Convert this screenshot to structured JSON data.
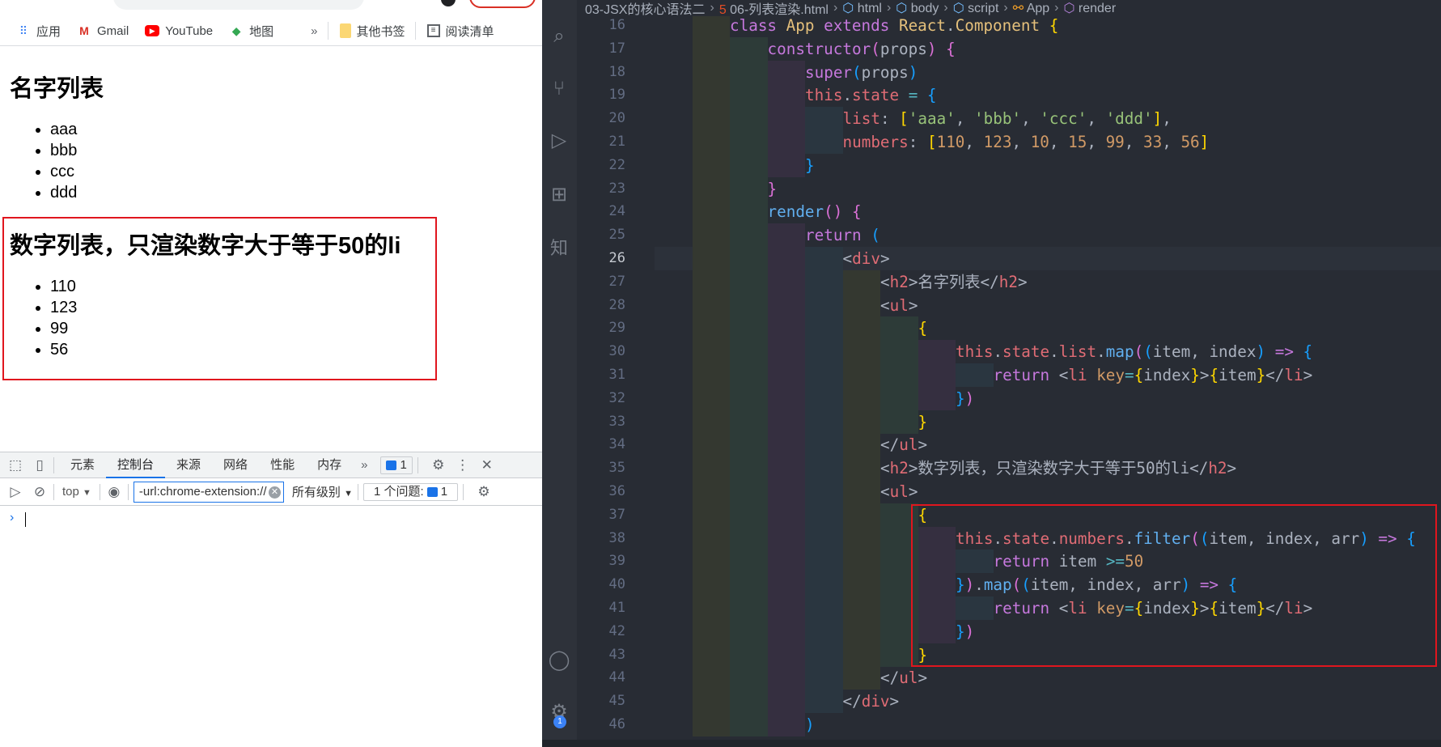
{
  "bookmarks": [
    {
      "label": "应用",
      "icon": "apps-grid-icon"
    },
    {
      "label": "Gmail",
      "icon": "gmail-icon"
    },
    {
      "label": "YouTube",
      "icon": "youtube-icon"
    },
    {
      "label": "地图",
      "icon": "maps-icon"
    }
  ],
  "bookmarks_more": "»",
  "other_bookmarks": "其他书签",
  "reading_list": "阅读清单",
  "page": {
    "h2_names": "名字列表",
    "names": [
      "aaa",
      "bbb",
      "ccc",
      "ddd"
    ],
    "h2_numbers": "数字列表，只渲染数字大于等于50的li",
    "numbers": [
      "110",
      "123",
      "99",
      "56"
    ]
  },
  "devtools": {
    "tabs": [
      "元素",
      "控制台",
      "来源",
      "网络",
      "性能",
      "内存"
    ],
    "active_tab": "控制台",
    "more": "»",
    "issues_badge": "1",
    "context": "top",
    "filter_value": "-url:chrome-extension://",
    "levels": "所有级别",
    "issues_label": "1 个问题:",
    "issues_count": "1",
    "prompt": "›"
  },
  "editor": {
    "breadcrumbs": [
      "03-JSX的核心语法二",
      "06-列表渲染.html",
      "html",
      "body",
      "script",
      "App",
      "render"
    ],
    "current_line": 26,
    "notification_count": "1",
    "highlight_color": "#e0161e",
    "lines": [
      {
        "n": 16,
        "i": 2,
        "t": [
          [
            "kw",
            "class "
          ],
          [
            "cls",
            "App "
          ],
          [
            "kw",
            "extends "
          ],
          [
            "cls",
            "React"
          ],
          [
            "df",
            "."
          ],
          [
            "cls",
            "Component "
          ],
          [
            "b1",
            "{"
          ]
        ]
      },
      {
        "n": 17,
        "i": 3,
        "t": [
          [
            "kw",
            "constructor"
          ],
          [
            "b2",
            "("
          ],
          [
            "df",
            "props"
          ],
          [
            "b2",
            ")"
          ],
          [
            "df",
            " "
          ],
          [
            "b2",
            "{"
          ]
        ]
      },
      {
        "n": 18,
        "i": 4,
        "t": [
          [
            "kw",
            "super"
          ],
          [
            "b3",
            "("
          ],
          [
            "df",
            "props"
          ],
          [
            "b3",
            ")"
          ]
        ]
      },
      {
        "n": 19,
        "i": 4,
        "t": [
          [
            "red",
            "this"
          ],
          [
            "df",
            "."
          ],
          [
            "red",
            "state "
          ],
          [
            "op",
            "= "
          ],
          [
            "b3",
            "{"
          ]
        ]
      },
      {
        "n": 20,
        "i": 5,
        "t": [
          [
            "red",
            "list"
          ],
          [
            "df",
            ": "
          ],
          [
            "b1",
            "["
          ],
          [
            "str",
            "'aaa'"
          ],
          [
            "df",
            ", "
          ],
          [
            "str",
            "'bbb'"
          ],
          [
            "df",
            ", "
          ],
          [
            "str",
            "'ccc'"
          ],
          [
            "df",
            ", "
          ],
          [
            "str",
            "'ddd'"
          ],
          [
            "b1",
            "]"
          ],
          [
            "df",
            ","
          ]
        ]
      },
      {
        "n": 21,
        "i": 5,
        "t": [
          [
            "red",
            "numbers"
          ],
          [
            "df",
            ": "
          ],
          [
            "b1",
            "["
          ],
          [
            "num",
            "110"
          ],
          [
            "df",
            ", "
          ],
          [
            "num",
            "123"
          ],
          [
            "df",
            ", "
          ],
          [
            "num",
            "10"
          ],
          [
            "df",
            ", "
          ],
          [
            "num",
            "15"
          ],
          [
            "df",
            ", "
          ],
          [
            "num",
            "99"
          ],
          [
            "df",
            ", "
          ],
          [
            "num",
            "33"
          ],
          [
            "df",
            ", "
          ],
          [
            "num",
            "56"
          ],
          [
            "b1",
            "]"
          ]
        ]
      },
      {
        "n": 22,
        "i": 4,
        "t": [
          [
            "b3",
            "}"
          ]
        ]
      },
      {
        "n": 23,
        "i": 3,
        "t": [
          [
            "b2",
            "}"
          ]
        ]
      },
      {
        "n": 24,
        "i": 3,
        "t": [
          [
            "fn",
            "render"
          ],
          [
            "b2",
            "()"
          ],
          [
            "df",
            " "
          ],
          [
            "b2",
            "{"
          ]
        ]
      },
      {
        "n": 25,
        "i": 4,
        "t": [
          [
            "kw",
            "return "
          ],
          [
            "b3",
            "("
          ]
        ]
      },
      {
        "n": 26,
        "i": 5,
        "t": [
          [
            "df",
            "<"
          ],
          [
            "red",
            "div"
          ],
          [
            "df",
            ">"
          ]
        ]
      },
      {
        "n": 27,
        "i": 6,
        "t": [
          [
            "df",
            "<"
          ],
          [
            "red",
            "h2"
          ],
          [
            "df",
            ">名字列表</"
          ],
          [
            "red",
            "h2"
          ],
          [
            "df",
            ">"
          ]
        ]
      },
      {
        "n": 28,
        "i": 6,
        "t": [
          [
            "df",
            "<"
          ],
          [
            "red",
            "ul"
          ],
          [
            "df",
            ">"
          ]
        ]
      },
      {
        "n": 29,
        "i": 7,
        "t": [
          [
            "b1",
            "{"
          ]
        ]
      },
      {
        "n": 30,
        "i": 8,
        "t": [
          [
            "red",
            "this"
          ],
          [
            "df",
            "."
          ],
          [
            "red",
            "state"
          ],
          [
            "df",
            "."
          ],
          [
            "red",
            "list"
          ],
          [
            "df",
            "."
          ],
          [
            "fn",
            "map"
          ],
          [
            "b2",
            "("
          ],
          [
            "b3",
            "("
          ],
          [
            "df",
            "item, index"
          ],
          [
            "b3",
            ")"
          ],
          [
            "df",
            " "
          ],
          [
            "kw",
            "=>"
          ],
          [
            "df",
            " "
          ],
          [
            "b3",
            "{"
          ]
        ]
      },
      {
        "n": 31,
        "i": 9,
        "t": [
          [
            "kw",
            "return "
          ],
          [
            "df",
            "<"
          ],
          [
            "red",
            "li "
          ],
          [
            "num",
            "key"
          ],
          [
            "op",
            "="
          ],
          [
            "b1",
            "{"
          ],
          [
            "df",
            "index"
          ],
          [
            "b1",
            "}"
          ],
          [
            "df",
            ">"
          ],
          [
            "b1",
            "{"
          ],
          [
            "df",
            "item"
          ],
          [
            "b1",
            "}"
          ],
          [
            "df",
            "</"
          ],
          [
            "red",
            "li"
          ],
          [
            "df",
            ">"
          ]
        ]
      },
      {
        "n": 32,
        "i": 8,
        "t": [
          [
            "b3",
            "}"
          ],
          [
            "b2",
            ")"
          ]
        ]
      },
      {
        "n": 33,
        "i": 7,
        "t": [
          [
            "b1",
            "}"
          ]
        ]
      },
      {
        "n": 34,
        "i": 6,
        "t": [
          [
            "df",
            "</"
          ],
          [
            "red",
            "ul"
          ],
          [
            "df",
            ">"
          ]
        ]
      },
      {
        "n": 35,
        "i": 6,
        "t": [
          [
            "df",
            "<"
          ],
          [
            "red",
            "h2"
          ],
          [
            "df",
            ">数字列表，只渲染数字大于等于50的li</"
          ],
          [
            "red",
            "h2"
          ],
          [
            "df",
            ">"
          ]
        ]
      },
      {
        "n": 36,
        "i": 6,
        "t": [
          [
            "df",
            "<"
          ],
          [
            "red",
            "ul"
          ],
          [
            "df",
            ">"
          ]
        ]
      },
      {
        "n": 37,
        "i": 7,
        "t": [
          [
            "b1",
            "{"
          ]
        ]
      },
      {
        "n": 38,
        "i": 8,
        "t": [
          [
            "red",
            "this"
          ],
          [
            "df",
            "."
          ],
          [
            "red",
            "state"
          ],
          [
            "df",
            "."
          ],
          [
            "red",
            "numbers"
          ],
          [
            "df",
            "."
          ],
          [
            "fn",
            "filter"
          ],
          [
            "b2",
            "("
          ],
          [
            "b3",
            "("
          ],
          [
            "df",
            "item, index, arr"
          ],
          [
            "b3",
            ")"
          ],
          [
            "df",
            " "
          ],
          [
            "kw",
            "=>"
          ],
          [
            "df",
            " "
          ],
          [
            "b3",
            "{"
          ]
        ]
      },
      {
        "n": 39,
        "i": 9,
        "t": [
          [
            "kw",
            "return "
          ],
          [
            "df",
            "item "
          ],
          [
            "op",
            ">="
          ],
          [
            "num",
            "50"
          ]
        ]
      },
      {
        "n": 40,
        "i": 8,
        "t": [
          [
            "b3",
            "}"
          ],
          [
            "b2",
            ")"
          ],
          [
            "df",
            "."
          ],
          [
            "fn",
            "map"
          ],
          [
            "b2",
            "("
          ],
          [
            "b3",
            "("
          ],
          [
            "df",
            "item, index, arr"
          ],
          [
            "b3",
            ")"
          ],
          [
            "df",
            " "
          ],
          [
            "kw",
            "=>"
          ],
          [
            "df",
            " "
          ],
          [
            "b3",
            "{"
          ]
        ]
      },
      {
        "n": 41,
        "i": 9,
        "t": [
          [
            "kw",
            "return "
          ],
          [
            "df",
            "<"
          ],
          [
            "red",
            "li "
          ],
          [
            "num",
            "key"
          ],
          [
            "op",
            "="
          ],
          [
            "b1",
            "{"
          ],
          [
            "df",
            "index"
          ],
          [
            "b1",
            "}"
          ],
          [
            "df",
            ">"
          ],
          [
            "b1",
            "{"
          ],
          [
            "df",
            "item"
          ],
          [
            "b1",
            "}"
          ],
          [
            "df",
            "</"
          ],
          [
            "red",
            "li"
          ],
          [
            "df",
            ">"
          ]
        ]
      },
      {
        "n": 42,
        "i": 8,
        "t": [
          [
            "b3",
            "}"
          ],
          [
            "b2",
            ")"
          ]
        ]
      },
      {
        "n": 43,
        "i": 7,
        "t": [
          [
            "b1",
            "}"
          ]
        ]
      },
      {
        "n": 44,
        "i": 6,
        "t": [
          [
            "df",
            "</"
          ],
          [
            "red",
            "ul"
          ],
          [
            "df",
            ">"
          ]
        ]
      },
      {
        "n": 45,
        "i": 5,
        "t": [
          [
            "df",
            "</"
          ],
          [
            "red",
            "div"
          ],
          [
            "df",
            ">"
          ]
        ]
      },
      {
        "n": 46,
        "i": 4,
        "t": [
          [
            "b3",
            ")"
          ]
        ]
      }
    ]
  }
}
